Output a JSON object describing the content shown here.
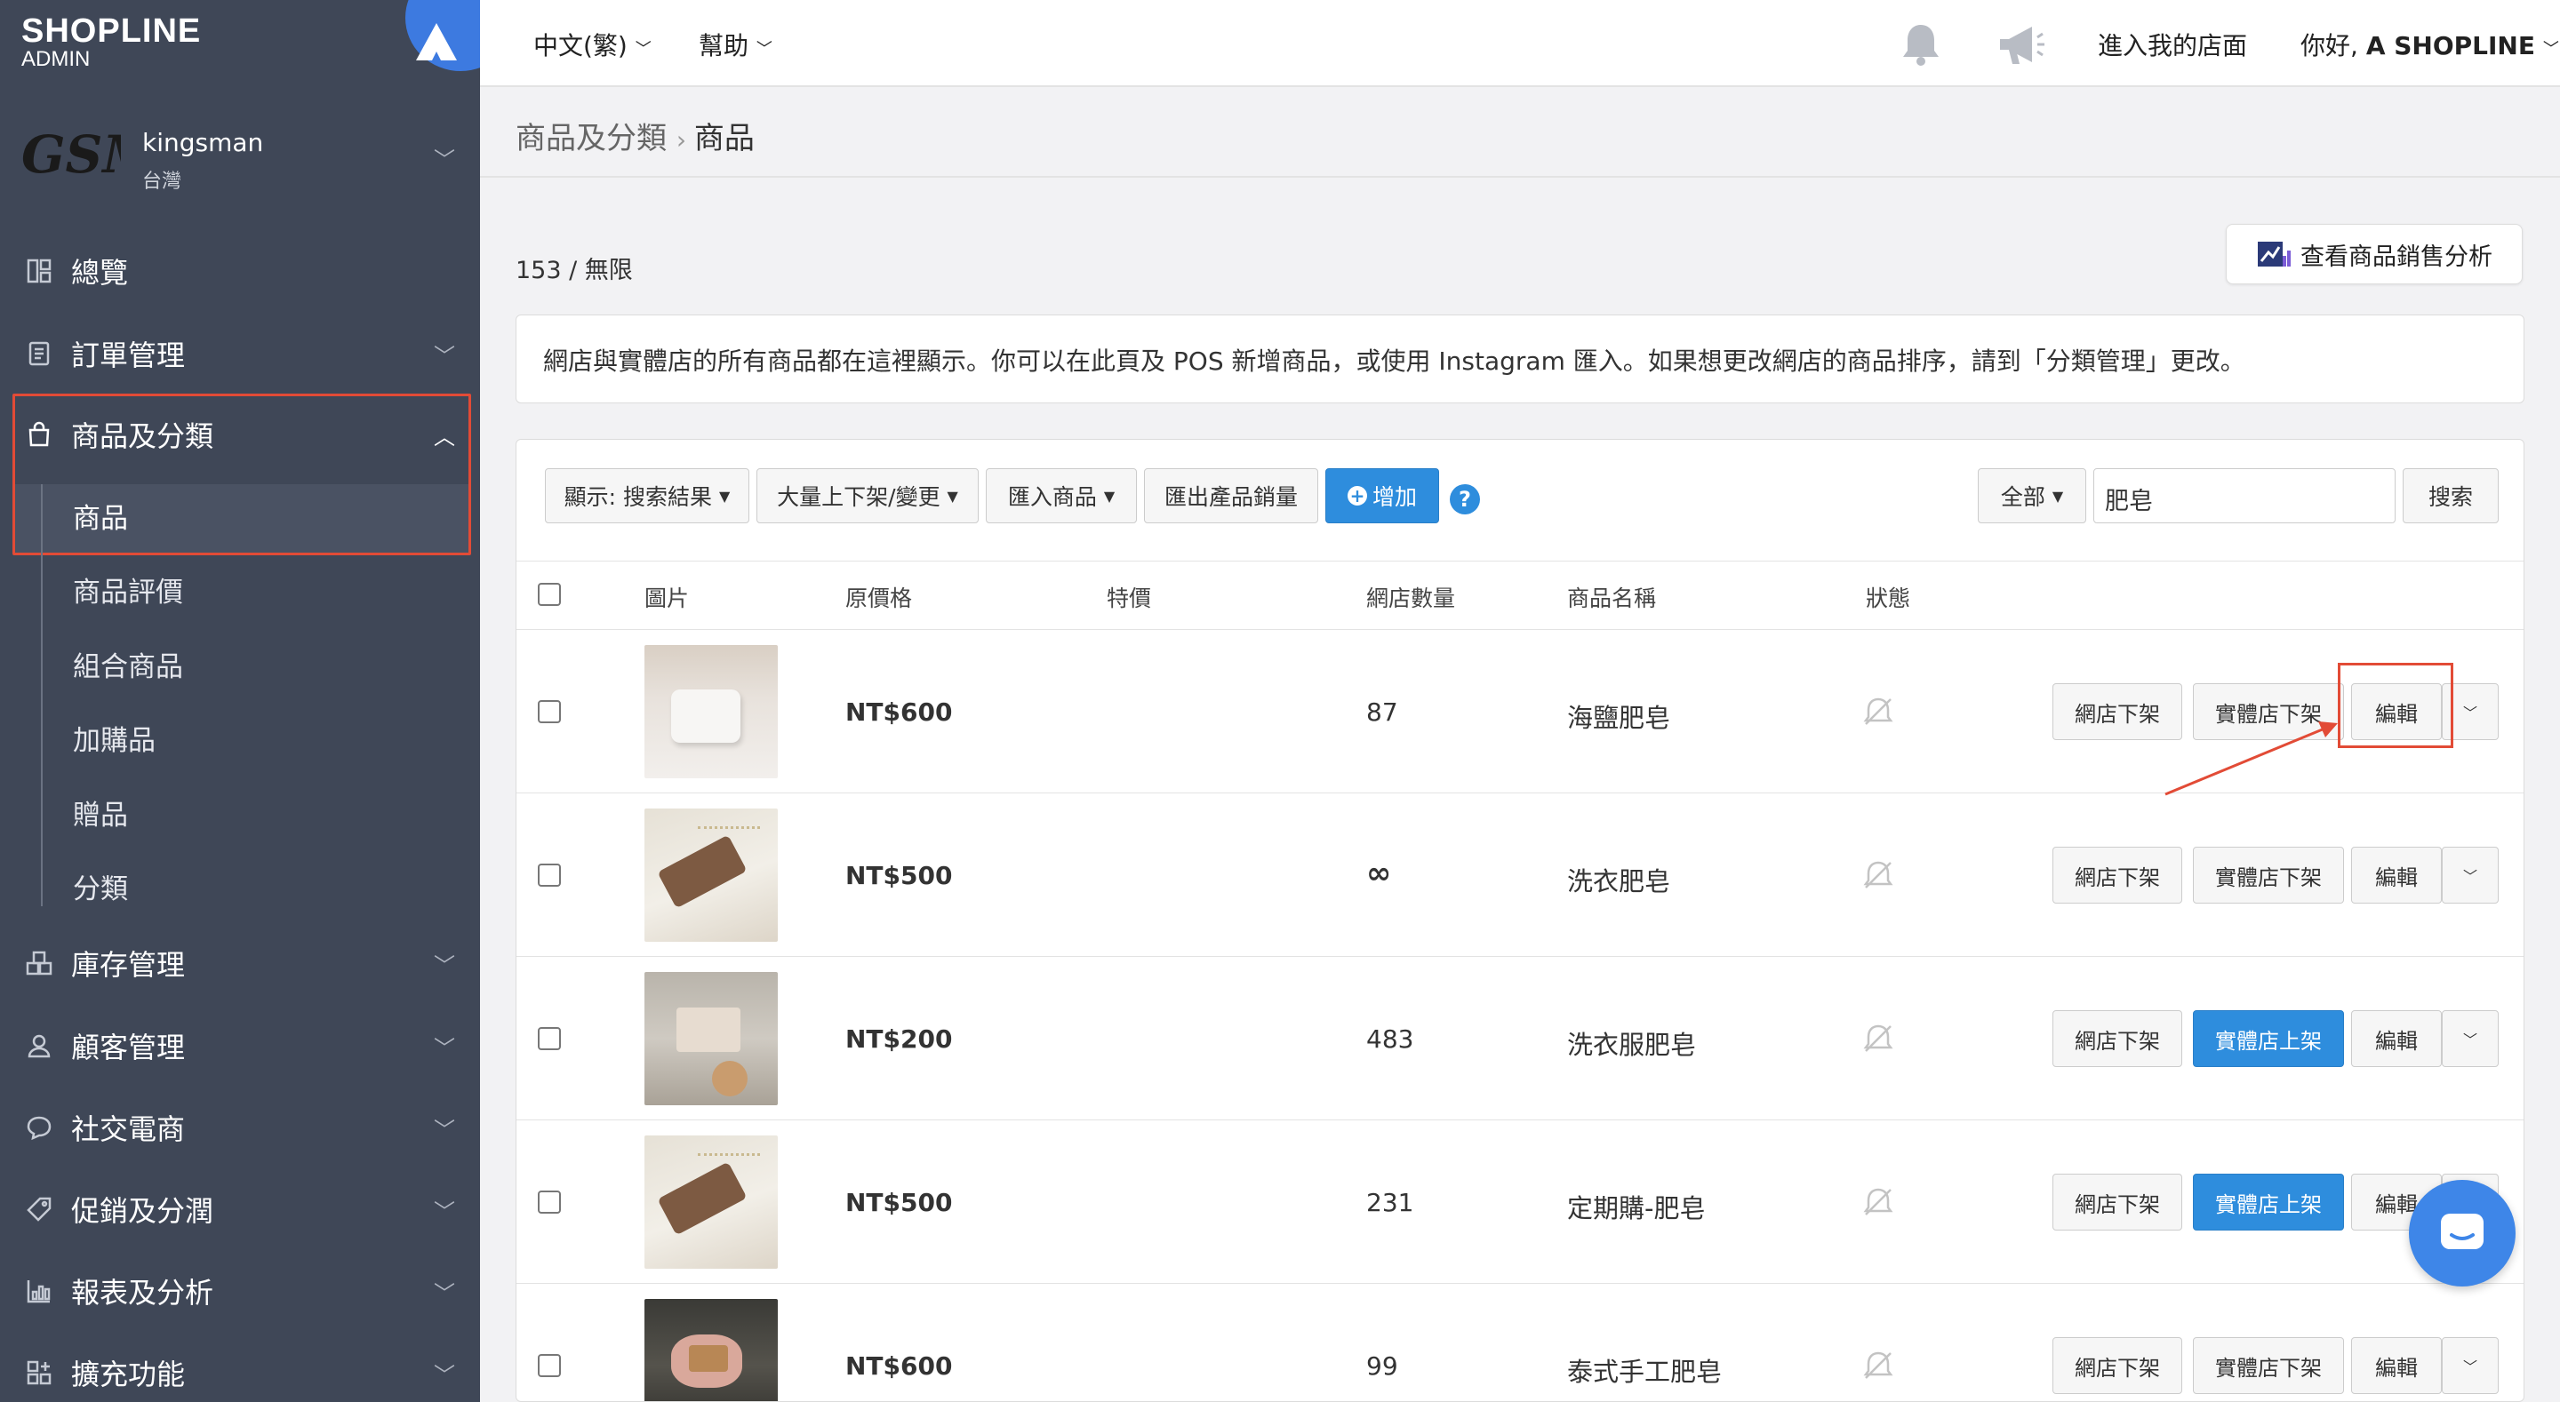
{
  "app": {
    "logo_main": "SHOPLINE",
    "logo_sub": "ADMIN"
  },
  "store": {
    "logo_text": "GSM",
    "name": "kingsman",
    "region": "台灣"
  },
  "sidebar": {
    "items": [
      {
        "label": "總覽",
        "icon": "dashboard-icon",
        "expandable": false
      },
      {
        "label": "訂單管理",
        "icon": "order-icon",
        "expandable": true
      },
      {
        "label": "商品及分類",
        "icon": "bag-icon",
        "expandable": true,
        "expanded": true
      },
      {
        "label": "庫存管理",
        "icon": "inventory-icon",
        "expandable": true
      },
      {
        "label": "顧客管理",
        "icon": "customer-icon",
        "expandable": true
      },
      {
        "label": "社交電商",
        "icon": "chat-bubble-icon",
        "expandable": true
      },
      {
        "label": "促銷及分潤",
        "icon": "tag-icon",
        "expandable": true
      },
      {
        "label": "報表及分析",
        "icon": "report-icon",
        "expandable": true
      },
      {
        "label": "擴充功能",
        "icon": "apps-icon",
        "expandable": true
      }
    ],
    "sub_items": [
      "商品",
      "商品評價",
      "組合商品",
      "加購品",
      "贈品",
      "分類"
    ],
    "active_sub": "商品"
  },
  "topbar": {
    "language": "中文(繁)",
    "help": "幫助",
    "visit_store": "進入我的店面",
    "greeting_prefix": "你好,",
    "greeting_name": "A SHOPLINE"
  },
  "breadcrumb": {
    "parent": "商品及分類",
    "current": "商品"
  },
  "product_count": "153 / 無限",
  "analysis_button": "查看商品銷售分析",
  "info_text": "網店與實體店的所有商品都在這裡顯示。你可以在此頁及 POS 新增商品，或使用 Instagram 匯入。如果想更改網店的商品排序，請到「分類管理」更改。",
  "toolbar": {
    "display": "顯示: 搜索結果",
    "bulk": "大量上下架/變更",
    "import": "匯入商品",
    "export": "匯出產品銷量",
    "add": "增加",
    "scope": "全部",
    "search_value": "肥皂",
    "search_button": "搜索"
  },
  "table": {
    "headers": {
      "image": "圖片",
      "price": "原價格",
      "sale": "特價",
      "qty": "網店數量",
      "name": "商品名稱",
      "status": "狀態"
    },
    "rows": [
      {
        "price": "NT$600",
        "qty": "87",
        "name": "海鹽肥皂",
        "online_btn": "網店下架",
        "store_btn": "實體店下架",
        "store_btn_primary": false,
        "edit": "編輯"
      },
      {
        "price": "NT$500",
        "qty": "∞",
        "name": "洗衣肥皂",
        "online_btn": "網店下架",
        "store_btn": "實體店下架",
        "store_btn_primary": false,
        "edit": "編輯"
      },
      {
        "price": "NT$200",
        "qty": "483",
        "name": "洗衣服肥皂",
        "online_btn": "網店下架",
        "store_btn": "實體店上架",
        "store_btn_primary": true,
        "edit": "編輯"
      },
      {
        "price": "NT$500",
        "qty": "231",
        "name": "定期購-肥皂",
        "online_btn": "網店下架",
        "store_btn": "實體店上架",
        "store_btn_primary": true,
        "edit": "編輯"
      },
      {
        "price": "NT$600",
        "qty": "99",
        "name": "泰式手工肥皂",
        "online_btn": "網店下架",
        "store_btn": "實體店下架",
        "store_btn_primary": false,
        "edit": "編輯"
      }
    ]
  },
  "colors": {
    "sidebar": "#3f4757",
    "primary": "#2e8ddd",
    "annotation": "#e24b36",
    "chat": "#3e86e8"
  }
}
